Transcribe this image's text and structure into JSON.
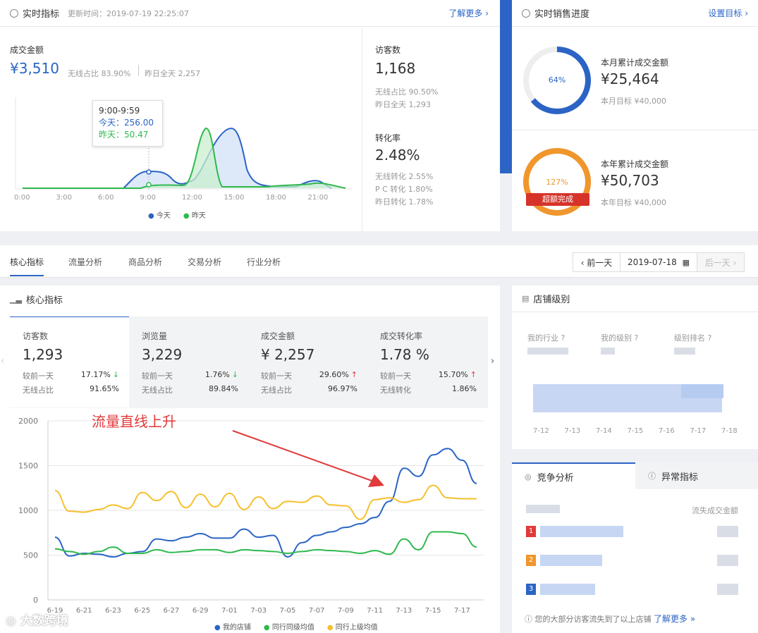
{
  "realtime": {
    "title": "实时指标",
    "updated": "更新时间：2019-07-19 22:25:07",
    "more": "了解更多 ›",
    "gmv_label": "成交金额",
    "gmv_value": "¥3,510",
    "wireless_share": "无线占比  83.90%",
    "yesterday_total": "昨日全天  2,257",
    "tooltip": {
      "time": "9:00-9:59",
      "today": "今天：256.00",
      "yesterday": "昨天：50.47"
    },
    "x_ticks": [
      "0:00",
      "3:00",
      "6:00",
      "9:00",
      "12:00",
      "15:00",
      "18:00",
      "21:00"
    ],
    "legend_today": "今天",
    "legend_yesterday": "昨天",
    "visitors_label": "访客数",
    "visitors_value": "1,168",
    "visitors_wireless": "无线占比  90.50%",
    "visitors_yesterday": "昨日全天  1,293",
    "conv_label": "转化率",
    "conv_value": "2.48%",
    "conv_wireless": "无线转化  2.55%",
    "conv_pc": "P C 转化  1.80%",
    "conv_yesterday": "昨日转化  1.78%"
  },
  "sales": {
    "title": "实时销售进度",
    "set_goal": "设置目标 ›",
    "month_pct": "64%",
    "month_label": "本月累计成交金额",
    "month_value": "¥25,464",
    "month_target": "本月目标  ¥40,000",
    "year_pct": "127%",
    "year_badge": "超额完成",
    "year_label": "本年累计成交金额",
    "year_value": "¥50,703",
    "year_target": "本年目标  ¥40,000",
    "month_progress": 0.64,
    "year_progress": 1.0
  },
  "tabs": [
    "核心指标",
    "流量分析",
    "商品分析",
    "交易分析",
    "行业分析"
  ],
  "datebar": {
    "prev": "‹ 前一天",
    "date": "2019-07-18",
    "next": "后一天 ›"
  },
  "core": {
    "title": "核心指标",
    "cards": [
      {
        "label": "访客数",
        "value": "1,293",
        "r1l": "较前一天",
        "r1v": "17.17%",
        "r1a": "↓",
        "r2l": "无线占比",
        "r2v": "91.65%"
      },
      {
        "label": "浏览量",
        "value": "3,229",
        "r1l": "较前一天",
        "r1v": "1.76%",
        "r1a": "↓",
        "r2l": "无线占比",
        "r2v": "89.84%"
      },
      {
        "label": "成交金额",
        "value": "¥ 2,257",
        "r1l": "较前一天",
        "r1v": "29.60%",
        "r1a": "↑",
        "r2l": "无线占比",
        "r2v": "96.97%"
      },
      {
        "label": "成交转化率",
        "value": "1.78 %",
        "r1l": "较前一天",
        "r1v": "15.70%",
        "r1a": "↑",
        "r2l": "无线转化",
        "r2v": "1.86%"
      }
    ],
    "annotation": "流量直线上升",
    "y_ticks": [
      "2000",
      "1500",
      "1000",
      "500",
      "0"
    ],
    "x_ticks": [
      "6-19",
      "6-21",
      "6-23",
      "6-25",
      "6-27",
      "6-29",
      "7-01",
      "7-03",
      "7-05",
      "7-07",
      "7-09",
      "7-11",
      "7-13",
      "7-15",
      "7-17"
    ],
    "legend": [
      "我的店铺",
      "同行同级均值",
      "同行上级均值"
    ]
  },
  "shop_level": {
    "title": "店铺级别",
    "cols": [
      "我的行业",
      "我的级别",
      "级别排名"
    ],
    "x_ticks": [
      "7-12",
      "7-13",
      "7-14",
      "7-15",
      "7-16",
      "7-17",
      "7-18"
    ]
  },
  "competition": {
    "tab_active": "竞争分析",
    "tab_other": "异常指标",
    "col_right": "流失成交金额",
    "ranks": [
      "1",
      "2",
      "3"
    ],
    "footer": "您的大部分访客流失到了以上店铺",
    "footer_link": "了解更多 »"
  },
  "watermark": "大数跨境",
  "colors": {
    "blue": "#2b64c5",
    "green": "#2fb94f",
    "yellow": "#f6bf2c",
    "red": "#e03a3a",
    "orange": "#f0962d"
  },
  "chart_data": [
    {
      "type": "line",
      "x": [
        "0:00",
        "3:00",
        "6:00",
        "9:00",
        "12:00",
        "15:00",
        "18:00",
        "21:00"
      ],
      "series": [
        {
          "name": "今天",
          "values": [
            0,
            0,
            0,
            256,
            80,
            700,
            0,
            50
          ]
        },
        {
          "name": "昨天",
          "values": [
            0,
            0,
            0,
            50,
            700,
            20,
            30,
            30
          ]
        }
      ]
    },
    {
      "type": "line",
      "x": [
        "6-19",
        "6-20",
        "6-21",
        "6-22",
        "6-23",
        "6-24",
        "6-25",
        "6-26",
        "6-27",
        "6-28",
        "6-29",
        "6-30",
        "7-01",
        "7-02",
        "7-03",
        "7-04",
        "7-05",
        "7-06",
        "7-07",
        "7-08",
        "7-09",
        "7-10",
        "7-11",
        "7-12",
        "7-13",
        "7-14",
        "7-15",
        "7-16",
        "7-17",
        "7-18"
      ],
      "ylim": [
        0,
        2000
      ],
      "series": [
        {
          "name": "我的店铺",
          "values": [
            700,
            490,
            520,
            510,
            480,
            520,
            540,
            680,
            660,
            700,
            740,
            690,
            690,
            790,
            700,
            720,
            480,
            640,
            720,
            760,
            810,
            850,
            920,
            1100,
            1470,
            1380,
            1620,
            1690,
            1560,
            1300
          ]
        },
        {
          "name": "同行同级均值",
          "values": [
            570,
            540,
            510,
            540,
            590,
            520,
            520,
            560,
            530,
            540,
            560,
            560,
            530,
            560,
            550,
            540,
            520,
            540,
            560,
            550,
            540,
            520,
            550,
            510,
            680,
            560,
            760,
            760,
            740,
            590
          ]
        },
        {
          "name": "同行上级均值",
          "values": [
            1220,
            990,
            980,
            1010,
            1060,
            1020,
            1200,
            1110,
            1210,
            1030,
            1180,
            1040,
            1190,
            1010,
            1150,
            1020,
            1100,
            1090,
            1160,
            1060,
            1050,
            900,
            1120,
            1140,
            1090,
            1120,
            1280,
            1140,
            1130,
            1130
          ]
        }
      ]
    }
  ]
}
